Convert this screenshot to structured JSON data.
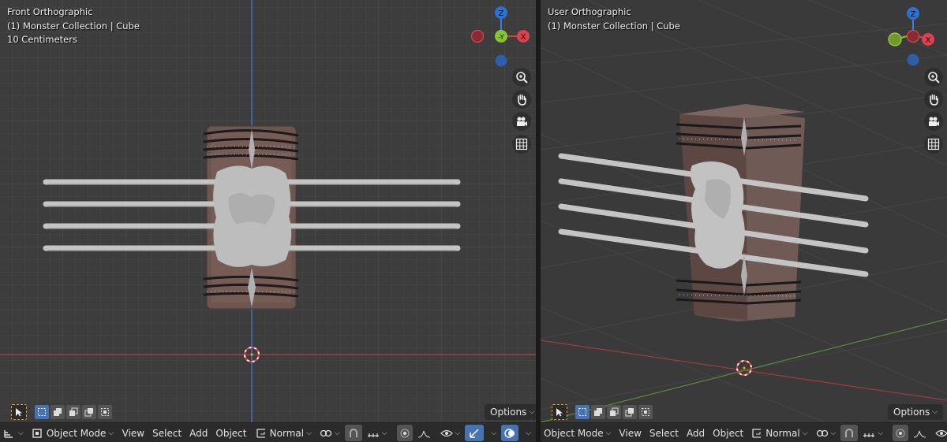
{
  "left_viewport": {
    "view_name": "Front Orthographic",
    "collection_info": "(1) Monster Collection | Cube",
    "scale_label": "10 Centimeters"
  },
  "right_viewport": {
    "view_name": "User Orthographic",
    "collection_info": "(1) Monster Collection | Cube"
  },
  "gizmo_labels": {
    "z": "Z",
    "neg_y": "-Y",
    "x": "X"
  },
  "bottom_bar": {
    "mode": "Object Mode",
    "menus": [
      "View",
      "Select",
      "Add",
      "Object"
    ],
    "orientation": "Normal"
  },
  "options_label": "Options",
  "colors": {
    "accent_blue": "#4772b3",
    "axis_x": "#e0404c",
    "axis_y": "#86c731",
    "axis_z": "#3d7ee2",
    "viewport_bg": "#3d3d3d",
    "header_bg": "#2b2b2b"
  },
  "icons": [
    "zoom-icon",
    "hand-icon",
    "camera-icon",
    "grid-icon",
    "select-box-icon",
    "cursor-icon",
    "transform-icon",
    "snap-icon",
    "proportional-icon",
    "overlay-icon",
    "gizmo-icon",
    "shading-icon"
  ]
}
